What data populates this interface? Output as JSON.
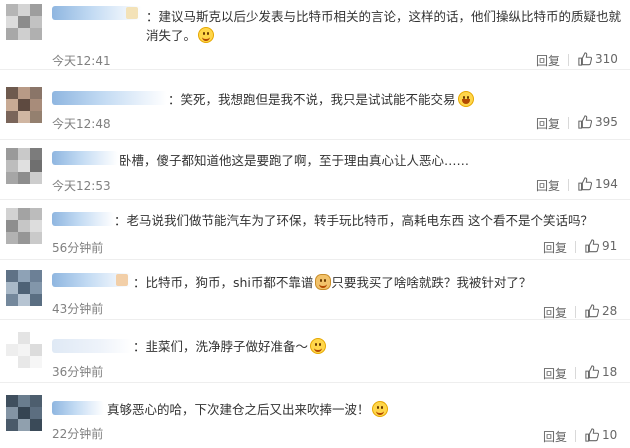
{
  "comments": [
    {
      "text": "：建议马斯克以后少发表与比特币相关的言论，这样的话，他们操纵比特币的质疑也就消失了。",
      "emoji": "smile",
      "time": "今天12:41",
      "reply": "回复",
      "likes": "310"
    },
    {
      "text": "：笑死，我想跑但是我不说，我只是试试能不能交易",
      "emoji": "laugh",
      "time": "今天12:48",
      "reply": "回复",
      "likes": "395"
    },
    {
      "text": "卧槽，傻子都知道他这是要跑了啊，至于理由真心让人恶心……",
      "emoji": "",
      "time": "今天12:53",
      "reply": "回复",
      "likes": "194"
    },
    {
      "text": "：老马说我们做节能汽车为了环保，转手玩比特币，高耗电东西 这个看不是个笑话吗？",
      "emoji": "",
      "time": "56分钟前",
      "reply": "回复",
      "likes": "91"
    },
    {
      "text_a": "：比特币，狗币，shi币都不靠谱",
      "text_b": "只要我买了啥啥就跌？我被针对了？",
      "emoji": "doge",
      "time": "43分钟前",
      "reply": "回复",
      "likes": "28"
    },
    {
      "text": "：韭菜们，洗净脖子做好准备～",
      "emoji": "smile",
      "time": "36分钟前",
      "reply": "回复",
      "likes": "18"
    },
    {
      "text": "真够恶心的哈，下次建仓之后又出来吹捧一波！",
      "emoji": "smile",
      "time": "22分钟前",
      "reply": "回复",
      "likes": "10"
    }
  ],
  "colors": {
    "text": "#333333",
    "meta": "#808080",
    "name_blur": "#8fb6e0",
    "emoji": "#ffd64a"
  },
  "icons": {
    "like": "thumbs-up-icon"
  }
}
